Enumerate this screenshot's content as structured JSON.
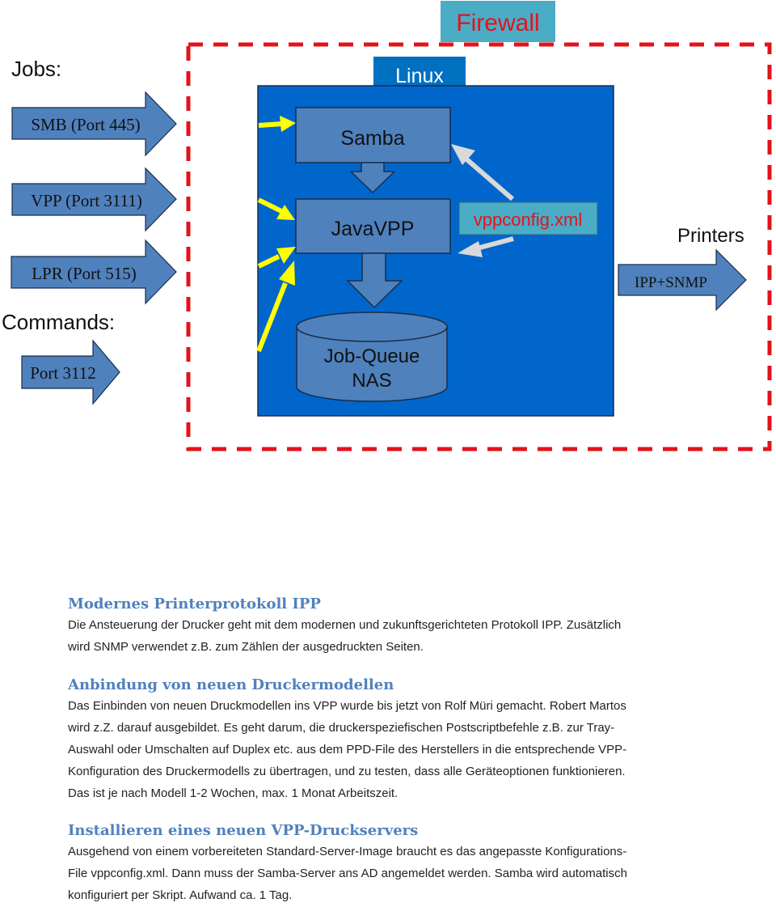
{
  "diagram": {
    "jobs_label": "Jobs:",
    "commands_label": "Commands:",
    "firewall_label": "Firewall",
    "linux_label": "Linux",
    "inbound_arrows": [
      {
        "label": "SMB (Port 445)"
      },
      {
        "label": "VPP (Port 3111)"
      },
      {
        "label": "LPR (Port 515)"
      },
      {
        "label": "Port 3112"
      }
    ],
    "components": {
      "samba": "Samba",
      "javavpp": "JavaVPP",
      "queue_line1": "Job-Queue",
      "queue_line2": "NAS",
      "config": "vppconfig.xml"
    },
    "printers_label": "Printers",
    "outbound_arrow": {
      "label": "IPP+SNMP"
    },
    "colors": {
      "firewall_border": "#e3131b",
      "firewall_label_bg": "#4bacc6",
      "linux_bg": "#0066cc",
      "component_fill": "#4f81bd",
      "input_arrow": "#ffff00",
      "config_arrow": "#d9d9d9",
      "config_text": "#e3131b"
    }
  },
  "document": {
    "sections": [
      {
        "heading": "Modernes Printerprotokoll IPP",
        "lines": [
          "Die Ansteuerung der  Drucker geht mit dem modernen und zukunftsgerichteten Protokoll IPP. Zusätzlich",
          "wird SNMP verwendet z.B. zum Zählen der ausgedruckten Seiten."
        ]
      },
      {
        "heading": "Anbindung von neuen Druckermodellen",
        "lines": [
          "Das Einbinden von neuen Druckmodellen ins VPP wurde bis jetzt von Rolf Müri gemacht. Robert Martos",
          "wird z.Z. darauf ausgebildet. Es geht darum, die druckerspeziefischen Postscriptbefehle z.B. zur Tray-",
          "Auswahl oder Umschalten auf Duplex etc. aus dem PPD-File des Herstellers in die entsprechende VPP-",
          "Konfiguration des Druckermodells zu übertragen, und zu testen, dass alle Geräteoptionen funktionieren.",
          "Das ist je nach Modell 1-2 Wochen, max. 1 Monat Arbeitszeit."
        ]
      },
      {
        "heading": "Installieren eines neuen VPP-Druckservers",
        "lines": [
          "Ausgehend von einem vorbereiteten Standard-Server-Image braucht es das angepasste Konfigurations-",
          "File vppconfig.xml. Dann muss der Samba-Server ans AD angemeldet werden. Samba wird automatisch",
          "konfiguriert per Skript. Aufwand ca. 1 Tag."
        ]
      }
    ]
  }
}
